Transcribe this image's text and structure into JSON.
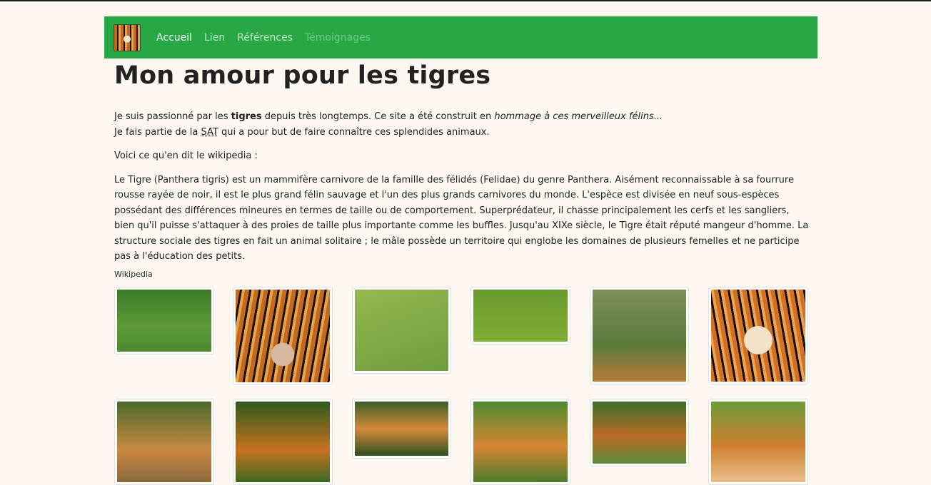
{
  "nav": {
    "logo_icon": "tiger-logo-icon",
    "links": [
      {
        "label": "Accueil",
        "state": "active"
      },
      {
        "label": "Lien",
        "state": "normal"
      },
      {
        "label": "Références",
        "state": "normal"
      },
      {
        "label": "Témoignages",
        "state": "disabled"
      }
    ],
    "bg_color": "#28a745"
  },
  "page": {
    "title": "Mon amour pour les tigres",
    "intro": {
      "p1_before": "Je suis passionné par les ",
      "p1_bold": "tigres",
      "p1_middle": " depuis très longtemps. Ce site a été construit en ",
      "p1_italic": "hommage à ces merveilleux félins...",
      "p2_before": "Je fais partie de la ",
      "p2_abbr": "SAT",
      "p2_after": " qui a pour but de faire connaître ces splendides animaux."
    },
    "wiki_intro": "Voici ce qu'en dit le wikipedia :",
    "wiki_quote": "Le Tigre (Panthera tigris) est un mammifère carnivore de la famille des félidés (Felidae) du genre Panthera. Aisément reconnaissable à sa fourrure rousse rayée de noir, il est le plus grand félin sauvage et l'un des plus grands carnivores du monde. L'espèce est divisée en neuf sous-espèces possédant des différences mineures en termes de taille ou de comportement. Superprédateur, il chasse principalement les cerfs et les sangliers, bien qu'il puisse s'attaquer à des proies de taille plus importante comme les buffles. Jusqu'au XIXe siècle, le Tigre était réputé mangeur d'homme. La structure sociale des tigres en fait un animal solitaire ; le mâle possède un territoire qui englobe les domaines de plusieurs femelles et ne participe pas à l'éducation des petits.",
    "wiki_source": "Wikipedia"
  },
  "gallery": {
    "images": [
      "tiger-photo-1",
      "tiger-photo-2",
      "tiger-photo-3",
      "tiger-photo-4",
      "tiger-photo-5",
      "tiger-photo-6",
      "tiger-photo-7",
      "tiger-photo-8",
      "tiger-photo-9",
      "tiger-photo-10",
      "tiger-photo-11",
      "tiger-photo-12"
    ]
  }
}
